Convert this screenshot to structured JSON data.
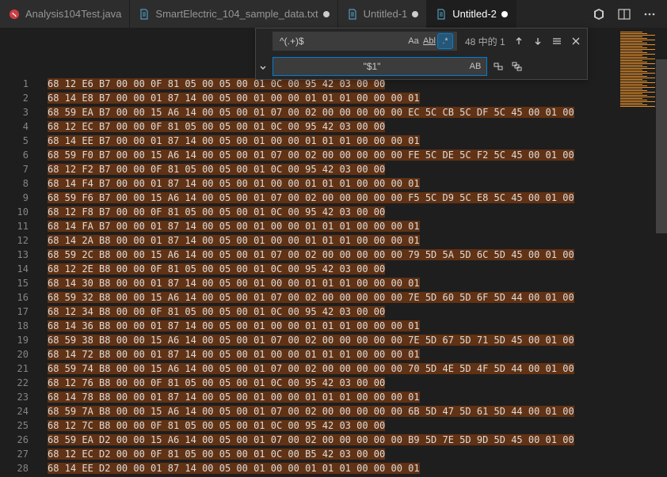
{
  "tabs": [
    {
      "label": "Analysis104Test.java",
      "icon": "java",
      "modified": false,
      "active": false
    },
    {
      "label": "SmartElectric_104_sample_data.txt",
      "icon": "text",
      "modified": true,
      "active": false
    },
    {
      "label": "Untitled-1",
      "icon": "text",
      "modified": true,
      "active": false
    },
    {
      "label": "Untitled-2",
      "icon": "text",
      "modified": true,
      "active": true
    }
  ],
  "find": {
    "search_value": "^(.+)$",
    "replace_value": "\"$1\"",
    "match_case_label": "Aa",
    "whole_word_label": "Abl",
    "regex_label": ".*",
    "regex_active": true,
    "preserve_case_label": "AB",
    "count_text": "48 中的 1"
  },
  "lines": [
    {
      "n": 1,
      "t": "68 12 E6 B7 00 00 0F 81 05 00 05 00 01 0C 00 95 42 03 00 00"
    },
    {
      "n": 2,
      "t": "68 14 E8 B7 00 00 01 87 14 00 05 00 01 00 00 01 01 01 00 00 00 01"
    },
    {
      "n": 3,
      "t": "68 59 EA B7 00 00 15 A6 14 00 05 00 01 07 00 02 00 00 00 00 00 EC 5C CB 5C DF 5C 45 00 01 00"
    },
    {
      "n": 4,
      "t": "68 12 EC B7 00 00 0F 81 05 00 05 00 01 0C 00 95 42 03 00 00"
    },
    {
      "n": 5,
      "t": "68 14 EE B7 00 00 01 87 14 00 05 00 01 00 00 01 01 01 00 00 00 01"
    },
    {
      "n": 6,
      "t": "68 59 F0 B7 00 00 15 A6 14 00 05 00 01 07 00 02 00 00 00 00 00 FE 5C DE 5C F2 5C 45 00 01 00"
    },
    {
      "n": 7,
      "t": "68 12 F2 B7 00 00 0F 81 05 00 05 00 01 0C 00 95 42 03 00 00"
    },
    {
      "n": 8,
      "t": "68 14 F4 B7 00 00 01 87 14 00 05 00 01 00 00 01 01 01 00 00 00 01"
    },
    {
      "n": 9,
      "t": "68 59 F6 B7 00 00 15 A6 14 00 05 00 01 07 00 02 00 00 00 00 00 F5 5C D9 5C E8 5C 45 00 01 00"
    },
    {
      "n": 10,
      "t": "68 12 F8 B7 00 00 0F 81 05 00 05 00 01 0C 00 95 42 03 00 00"
    },
    {
      "n": 11,
      "t": "68 14 FA B7 00 00 01 87 14 00 05 00 01 00 00 01 01 01 00 00 00 01"
    },
    {
      "n": 12,
      "t": "68 14 2A B8 00 00 01 87 14 00 05 00 01 00 00 01 01 01 00 00 00 01"
    },
    {
      "n": 13,
      "t": "68 59 2C B8 00 00 15 A6 14 00 05 00 01 07 00 02 00 00 00 00 00 79 5D 5A 5D 6C 5D 45 00 01 00"
    },
    {
      "n": 14,
      "t": "68 12 2E B8 00 00 0F 81 05 00 05 00 01 0C 00 95 42 03 00 00"
    },
    {
      "n": 15,
      "t": "68 14 30 B8 00 00 01 87 14 00 05 00 01 00 00 01 01 01 00 00 00 01"
    },
    {
      "n": 16,
      "t": "68 59 32 B8 00 00 15 A6 14 00 05 00 01 07 00 02 00 00 00 00 00 7E 5D 60 5D 6F 5D 44 00 01 00"
    },
    {
      "n": 17,
      "t": "68 12 34 B8 00 00 0F 81 05 00 05 00 01 0C 00 95 42 03 00 00"
    },
    {
      "n": 18,
      "t": "68 14 36 B8 00 00 01 87 14 00 05 00 01 00 00 01 01 01 00 00 00 01"
    },
    {
      "n": 19,
      "t": "68 59 38 B8 00 00 15 A6 14 00 05 00 01 07 00 02 00 00 00 00 00 7E 5D 67 5D 71 5D 45 00 01 00"
    },
    {
      "n": 20,
      "t": "68 14 72 B8 00 00 01 87 14 00 05 00 01 00 00 01 01 01 00 00 00 01"
    },
    {
      "n": 21,
      "t": "68 59 74 B8 00 00 15 A6 14 00 05 00 01 07 00 02 00 00 00 00 00 70 5D 4E 5D 4F 5D 44 00 01 00"
    },
    {
      "n": 22,
      "t": "68 12 76 B8 00 00 0F 81 05 00 05 00 01 0C 00 95 42 03 00 00"
    },
    {
      "n": 23,
      "t": "68 14 78 B8 00 00 01 87 14 00 05 00 01 00 00 01 01 01 00 00 00 01"
    },
    {
      "n": 24,
      "t": "68 59 7A B8 00 00 15 A6 14 00 05 00 01 07 00 02 00 00 00 00 00 6B 5D 47 5D 61 5D 44 00 01 00"
    },
    {
      "n": 25,
      "t": "68 12 7C B8 00 00 0F 81 05 00 05 00 01 0C 00 95 42 03 00 00"
    },
    {
      "n": 26,
      "t": "68 59 EA D2 00 00 15 A6 14 00 05 00 01 07 00 02 00 00 00 00 00 B9 5D 7E 5D 9D 5D 45 00 01 00"
    },
    {
      "n": 27,
      "t": "68 12 EC D2 00 00 0F 81 05 00 05 00 01 0C 00 B5 42 03 00 00"
    },
    {
      "n": 28,
      "t": "68 14 EE D2 00 00 01 87 14 00 05 00 01 00 00 01 01 01 00 00 00 01"
    }
  ],
  "icon_colors": {
    "java": "#cc3e44",
    "text": "#519aba"
  }
}
